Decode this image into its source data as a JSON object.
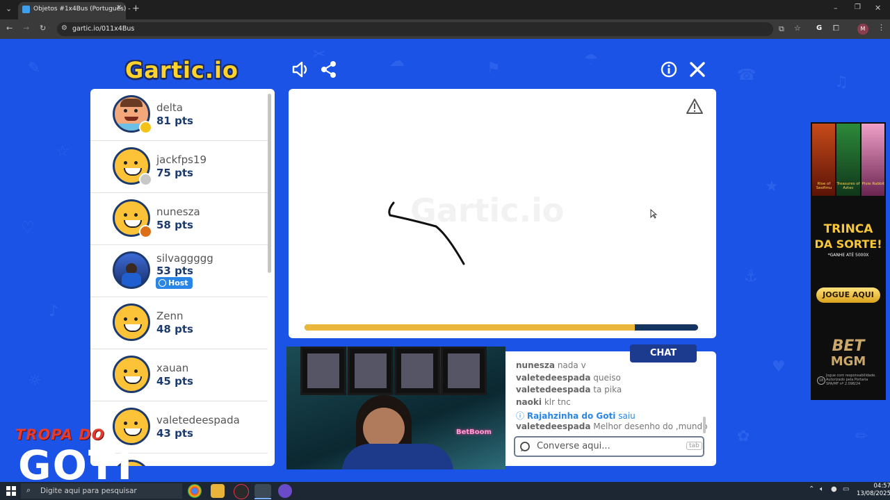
{
  "browser": {
    "tab_title": "Objetos #1x4Bus (Português) -",
    "new_tab": "+",
    "url": "gartic.io/011x4Bus",
    "profile_initial": "M",
    "ext_initial": "G"
  },
  "game": {
    "logo": "Gartic.io",
    "canvas_watermark": "Gartic.io",
    "progress": 0.84,
    "players": [
      {
        "name": "delta",
        "points": "81 pts",
        "badge_color": "#f5c21a",
        "avatar": "custom"
      },
      {
        "name": "jackfps19",
        "points": "75 pts",
        "badge_color": "#c8c8c8",
        "avatar": "default"
      },
      {
        "name": "nunesza",
        "points": "58 pts",
        "badge_color": "#dc6f17",
        "avatar": "default"
      },
      {
        "name": "silvaggggg",
        "points": "53 pts",
        "badge_color": "",
        "avatar": "photo"
      },
      {
        "name": "Zenn",
        "points": "48 pts",
        "badge_color": "",
        "avatar": "default"
      },
      {
        "name": "xauan",
        "points": "45 pts",
        "badge_color": "",
        "avatar": "default"
      },
      {
        "name": "valetedeespada",
        "points": "43 pts",
        "badge_color": "",
        "avatar": "default"
      }
    ],
    "host_label": "Host",
    "chat": {
      "tab_label": "CHAT",
      "placeholder": "Converse aqui...",
      "tab_key": "tab",
      "messages": [
        {
          "user": "nunesza",
          "text": "nada v"
        },
        {
          "user": "valetedeespada",
          "text": "queiso"
        },
        {
          "user": "valetedeespada",
          "text": "ta pika"
        },
        {
          "user": "naoki",
          "text": "klr tnc"
        },
        {
          "user": "Rajahzinha do Goti",
          "text": "saiu",
          "system": true
        },
        {
          "user": "valetedeespada",
          "text": "Melhor desenho do ,mundo"
        }
      ]
    }
  },
  "webcam": {
    "sign": "BetBoom"
  },
  "ad": {
    "slots": [
      "Rise of Seofimu",
      "Treasures of Aztec",
      "Pixie Rabbit"
    ],
    "headline1": "TRINCA",
    "headline2": "DA SORTE!",
    "sub": "*GANHE ATÉ 5000X",
    "cta": "JOGUE AQUI",
    "brand1": "BET",
    "brand2": "MGM",
    "disclaimer": "Jogue com responsabilidade. Autorizado pela Portaria SPA/MF nº 2.098/24",
    "age": "18"
  },
  "overlay": {
    "line1": "TROPA DO",
    "line2": "GOTI"
  },
  "taskbar": {
    "search_placeholder": "Digite aqui para pesquisar",
    "time": "04:57",
    "date": "13/08/2025"
  },
  "colors": {
    "page_blue": "#1a53e6",
    "navy": "#1c3a6e",
    "gold": "#e9b73a",
    "host_blue": "#2a86e6"
  }
}
